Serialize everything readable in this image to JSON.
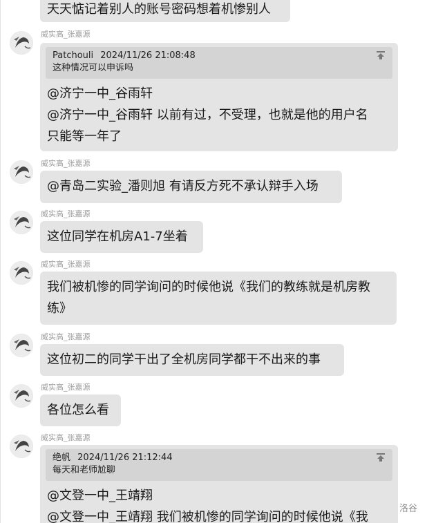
{
  "top_partial_message": {
    "text": "天天惦记着别人的账号密码想着机惨别人"
  },
  "messages": [
    {
      "sender": "威实高_张嘉源",
      "quote": {
        "name": "Patchouli",
        "time": "2024/11/26 21:08:48",
        "text": "这种情况可以申诉吗"
      },
      "lines": [
        "@济宁一中_谷雨轩",
        " @济宁一中_谷雨轩 以前有过，不受理，也就是他的用户名",
        "只能等一年了"
      ]
    },
    {
      "sender": "威实高_张嘉源",
      "lines": [
        "@青岛二实验_潘则旭 有请反方死不承认辩手入场"
      ]
    },
    {
      "sender": "威实高_张嘉源",
      "lines": [
        "这位同学在机房A1-7坐着"
      ]
    },
    {
      "sender": "威实高_张嘉源",
      "lines": [
        "我们被机惨的同学询问的时候他说《我们的教练就是机房教",
        "练》"
      ]
    },
    {
      "sender": "威实高_张嘉源",
      "lines": [
        "这位初二的同学干出了全机房同学都干不出来的事"
      ]
    },
    {
      "sender": "威实高_张嘉源",
      "lines": [
        "各位怎么看"
      ]
    },
    {
      "sender": "威实高_张嘉源",
      "quote": {
        "name": "绝帆",
        "time": "2024/11/26 21:12:44",
        "text": "每天和老师尬聊"
      },
      "lines": [
        "@文登一中_王靖翔",
        " @文登一中_王靖翔 我们被机惨的同学询问的时候他说《我"
      ]
    }
  ],
  "watermark": "洛谷",
  "icons": {
    "avatar": "avatar-ink-portrait-icon",
    "quote_pin": "pin-top-icon"
  },
  "colors": {
    "bubble": "#e4e4e4",
    "quote": "#d4d4d4",
    "sender": "#9a9a9a"
  }
}
